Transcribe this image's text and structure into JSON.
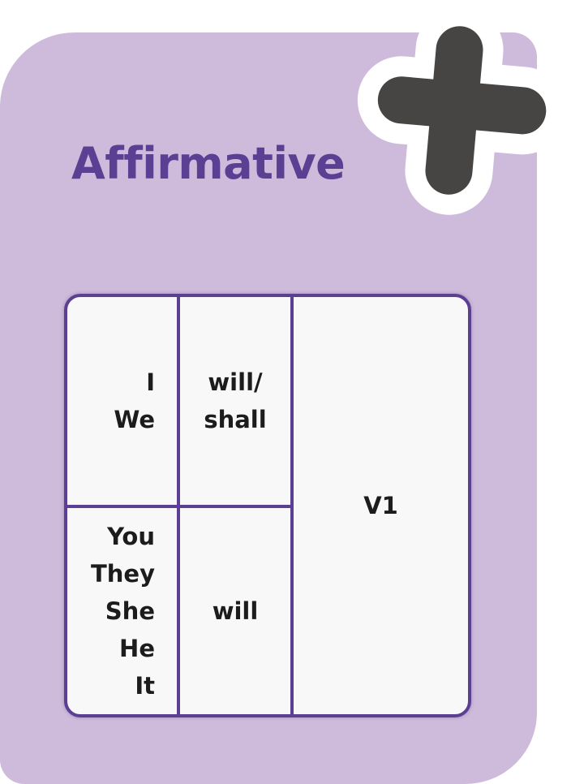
{
  "title": "Affirmative",
  "colors": {
    "card_background": "#cebbdb",
    "title_color": "#5b3f93",
    "table_border": "#5b3f93",
    "table_background": "#f9f8f8",
    "plus_icon": "#474444",
    "plus_halo": "#ffffff"
  },
  "badge": {
    "icon": "plus-icon"
  },
  "table": {
    "top_pronouns": [
      "I",
      "We"
    ],
    "top_auxiliary": [
      "will/",
      "shall"
    ],
    "bottom_pronouns": [
      "You",
      "They",
      "She",
      "He",
      "It"
    ],
    "bottom_auxiliary": [
      "will"
    ],
    "verb": "V1"
  }
}
